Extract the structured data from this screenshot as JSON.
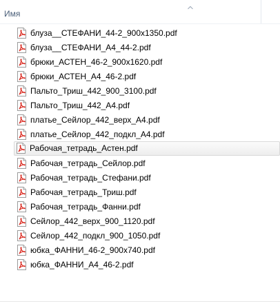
{
  "header": {
    "column_label": "Имя",
    "sort_icon": "chevron-up-icon"
  },
  "files": [
    {
      "name": "блуза__СТЕФАНИ_44-2_900x1350.pdf",
      "icon": "pdf-file-icon",
      "selected": false
    },
    {
      "name": "блуза__СТЕФАНИ_А4_44-2.pdf",
      "icon": "pdf-file-icon",
      "selected": false
    },
    {
      "name": "брюки_АСТЕН_46-2_900x1620.pdf",
      "icon": "pdf-file-icon",
      "selected": false
    },
    {
      "name": "брюки_АСТЕН_А4_46-2.pdf",
      "icon": "pdf-file-icon",
      "selected": false
    },
    {
      "name": "Пальто_Триш_442_900_3100.pdf",
      "icon": "pdf-file-icon",
      "selected": false
    },
    {
      "name": "Пальто_Триш_442_А4.pdf",
      "icon": "pdf-file-icon",
      "selected": false
    },
    {
      "name": "платье_Сейлор_442_верх_А4.pdf",
      "icon": "pdf-file-icon",
      "selected": false
    },
    {
      "name": "платье_Сейлор_442_подкл_А4.pdf",
      "icon": "pdf-file-icon",
      "selected": false
    },
    {
      "name": "Рабочая_тетрадь_Астен.pdf",
      "icon": "pdf-file-icon",
      "selected": true
    },
    {
      "name": "Рабочая_тетрадь_Сейлор.pdf",
      "icon": "pdf-file-icon",
      "selected": false
    },
    {
      "name": "Рабочая_тетрадь_Стефани.pdf",
      "icon": "pdf-file-icon",
      "selected": false
    },
    {
      "name": "Рабочая_тетрадь_Триш.pdf",
      "icon": "pdf-file-icon",
      "selected": false
    },
    {
      "name": "Рабочая_тетрадь_Фанни.pdf",
      "icon": "pdf-file-icon",
      "selected": false
    },
    {
      "name": "Сейлор_442_верх_900_1120.pdf",
      "icon": "pdf-file-icon",
      "selected": false
    },
    {
      "name": "Сейлор_442_подкл_900_1050.pdf",
      "icon": "pdf-file-icon",
      "selected": false
    },
    {
      "name": "юбка_ФАННИ_46-2_900x740.pdf",
      "icon": "pdf-file-icon",
      "selected": false
    },
    {
      "name": "юбка_ФАННИ_А4_46-2.pdf",
      "icon": "pdf-file-icon",
      "selected": false
    }
  ],
  "colors": {
    "header_text": "#4c607a",
    "pdf_icon_red": "#d9261c",
    "selection_border": "#d9d9d9"
  }
}
